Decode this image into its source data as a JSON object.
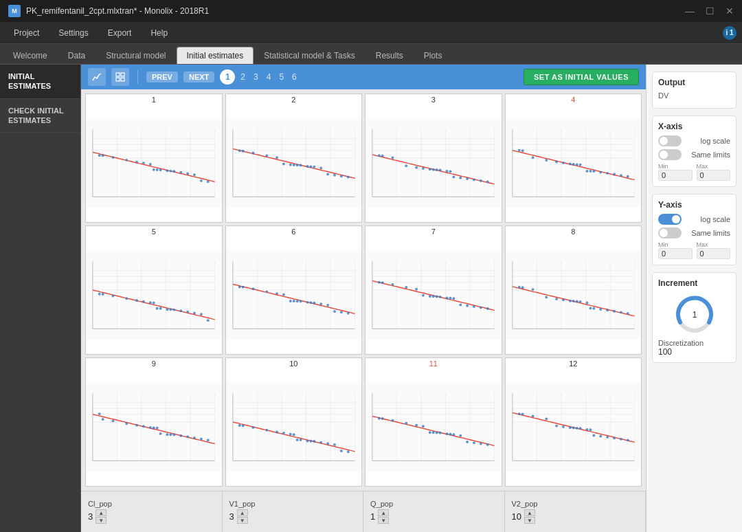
{
  "titlebar": {
    "logo_text": "M",
    "title": "PK_remifentanil_2cpt.mlxtran* - Monolix - 2018R1",
    "controls": [
      "—",
      "☐",
      "✕"
    ]
  },
  "menubar": {
    "items": [
      "Project",
      "Settings",
      "Export",
      "Help"
    ],
    "info": "i 1"
  },
  "tabs": [
    {
      "label": "Welcome",
      "active": false
    },
    {
      "label": "Data",
      "active": false
    },
    {
      "label": "Structural model",
      "active": false
    },
    {
      "label": "Initial estimates",
      "active": true
    },
    {
      "label": "Statistical model & Tasks",
      "active": false
    },
    {
      "label": "Results",
      "active": false
    },
    {
      "label": "Plots",
      "active": false
    }
  ],
  "sidebar": {
    "items": [
      {
        "label": "INITIAL ESTIMATES",
        "active": true
      },
      {
        "label": "CHECK INITIAL ESTIMATES",
        "active": false
      }
    ]
  },
  "toolbar": {
    "prev_label": "PREV",
    "next_label": "NEXT",
    "current_page": 1,
    "pages": [
      1,
      2,
      3,
      4,
      5,
      6
    ],
    "set_initial_label": "SET AS INITIAL VALUES"
  },
  "charts": [
    {
      "id": 1,
      "title": "1",
      "highlight": false
    },
    {
      "id": 2,
      "title": "2",
      "highlight": false
    },
    {
      "id": 3,
      "title": "3",
      "highlight": false
    },
    {
      "id": 4,
      "title": "4",
      "highlight": true
    },
    {
      "id": 5,
      "title": "5",
      "highlight": false
    },
    {
      "id": 6,
      "title": "6",
      "highlight": false
    },
    {
      "id": 7,
      "title": "7",
      "highlight": false
    },
    {
      "id": 8,
      "title": "8",
      "highlight": false
    },
    {
      "id": 9,
      "title": "9",
      "highlight": false
    },
    {
      "id": 10,
      "title": "10",
      "highlight": false
    },
    {
      "id": 11,
      "title": "11",
      "highlight": true
    },
    {
      "id": 12,
      "title": "12",
      "highlight": false
    }
  ],
  "params": [
    {
      "label": "Cl_pop",
      "value": "3"
    },
    {
      "label": "V1_pop",
      "value": "3"
    },
    {
      "label": "Q_pop",
      "value": "1"
    },
    {
      "label": "V2_pop",
      "value": "10"
    }
  ],
  "output_panel": {
    "title": "Output",
    "dv_label": "DV",
    "xaxis_title": "X-axis",
    "xaxis_log_label": "log scale",
    "xaxis_log_on": false,
    "xaxis_same_label": "Same limits",
    "xaxis_same_on": false,
    "xaxis_min": "0",
    "xaxis_max": "0",
    "yaxis_title": "Y-axis",
    "yaxis_log_label": "log scale",
    "yaxis_log_on": true,
    "yaxis_same_label": "Same limits",
    "yaxis_same_on": false,
    "yaxis_min": "0",
    "yaxis_max": "0",
    "increment_title": "Increment",
    "increment_value": "1",
    "discretization_label": "Discretization",
    "discretization_value": "100"
  }
}
